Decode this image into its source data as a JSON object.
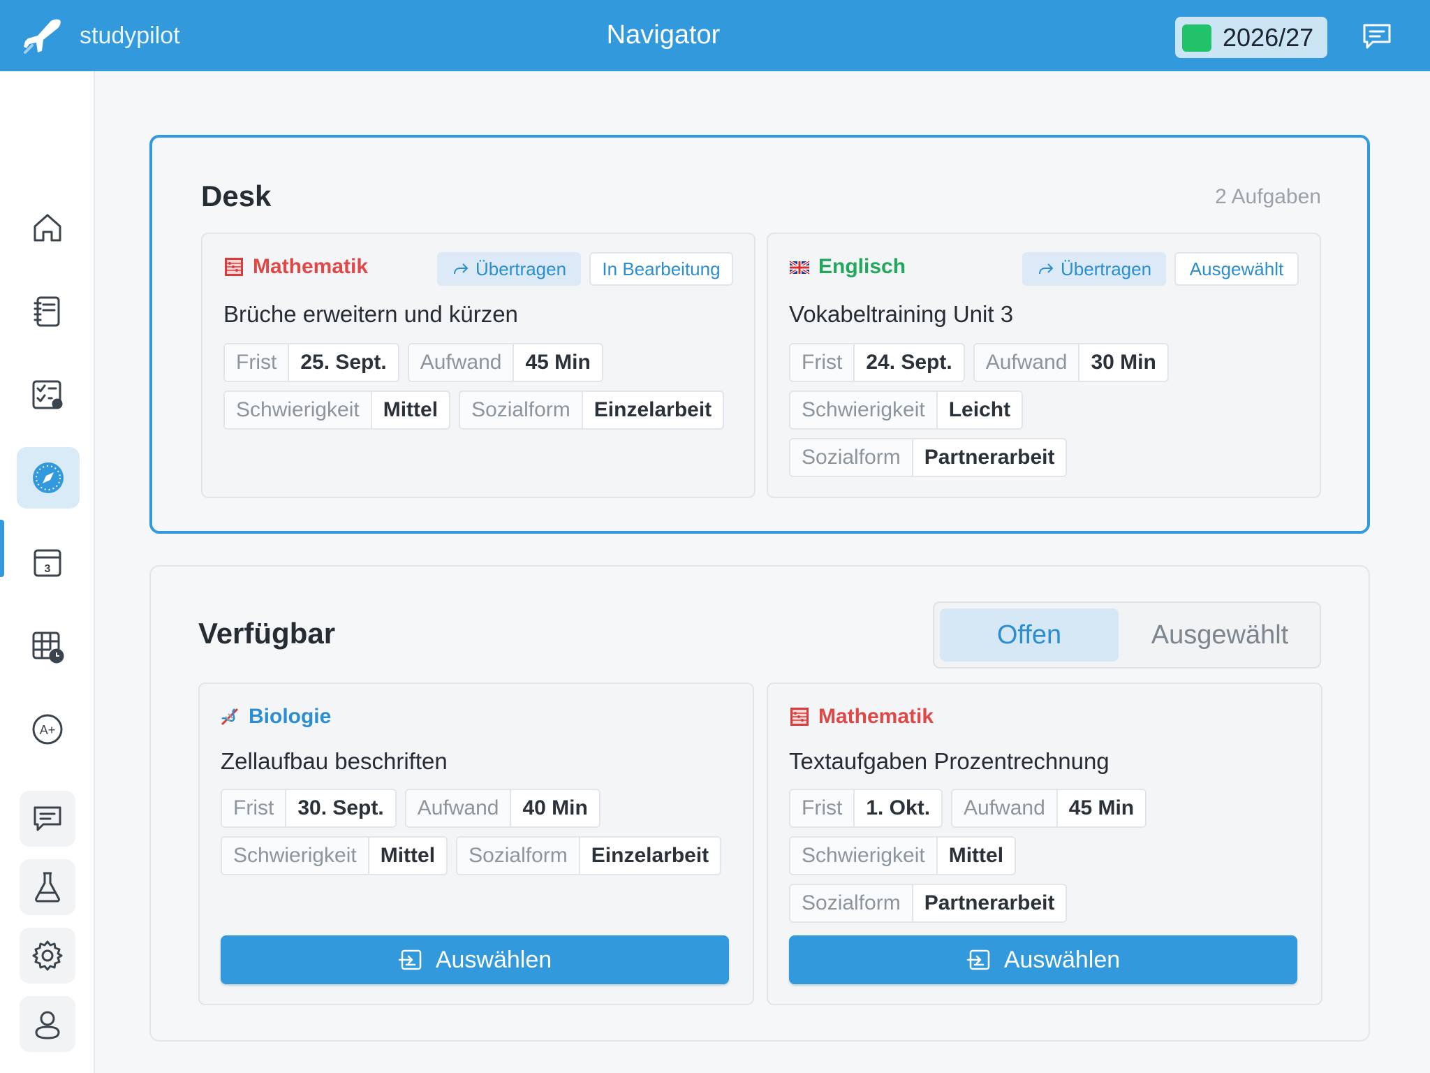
{
  "app": {
    "brand": "studypilot",
    "title": "Navigator",
    "year": "2026/27"
  },
  "colors": {
    "accent": "#3199dc",
    "math": "#e04848",
    "english": "#22a85a",
    "biology": "#2b8ed0",
    "status_dot": "#22c26b"
  },
  "sidebar": {
    "items": [
      {
        "icon": "home-icon"
      },
      {
        "icon": "notebook-icon"
      },
      {
        "icon": "task-checklist-icon"
      },
      {
        "icon": "compass-icon",
        "active": true
      },
      {
        "icon": "calendar-3-icon"
      },
      {
        "icon": "timetable-clock-icon"
      },
      {
        "icon": "grade-a-plus-icon"
      },
      {
        "icon": "chat-icon"
      },
      {
        "icon": "flask-icon"
      },
      {
        "icon": "gear-icon"
      },
      {
        "icon": "user-icon"
      }
    ]
  },
  "desk": {
    "title": "Desk",
    "count": "2 Aufgaben",
    "cards": [
      {
        "subject": "Mathematik",
        "subject_icon": "abacus-icon",
        "transfer": "Übertragen",
        "status": "In Bearbeitung",
        "title": "Brüche erweitern und kürzen",
        "frist_k": "Frist",
        "frist_v": "25. Sept.",
        "aufwand_k": "Aufwand",
        "aufwand_v": "45 Min",
        "schw_k": "Schwierigkeit",
        "schw_v": "Mittel",
        "sozial_k": "Sozialform",
        "sozial_v": "Einzelarbeit"
      },
      {
        "subject": "Englisch",
        "subject_icon": "uk-flag-icon",
        "transfer": "Übertragen",
        "status": "Ausgewählt",
        "title": "Vokabeltraining Unit 3",
        "frist_k": "Frist",
        "frist_v": "24. Sept.",
        "aufwand_k": "Aufwand",
        "aufwand_v": "30 Min",
        "schw_k": "Schwierigkeit",
        "schw_v": "Leicht",
        "sozial_k": "Sozialform",
        "sozial_v": "Partnerarbeit"
      }
    ]
  },
  "available": {
    "title": "Verfügbar",
    "tabs": [
      "Offen",
      "Ausgewählt"
    ],
    "active_tab": "Offen",
    "select_label": "Auswählen",
    "cards": [
      {
        "subject": "Biologie",
        "subject_icon": "dna-icon",
        "title": "Zellaufbau beschriften",
        "frist_k": "Frist",
        "frist_v": "30. Sept.",
        "aufwand_k": "Aufwand",
        "aufwand_v": "40 Min",
        "schw_k": "Schwierigkeit",
        "schw_v": "Mittel",
        "sozial_k": "Sozialform",
        "sozial_v": "Einzelarbeit"
      },
      {
        "subject": "Mathematik",
        "subject_icon": "abacus-icon",
        "title": "Textaufgaben Prozentrechnung",
        "frist_k": "Frist",
        "frist_v": "1. Okt.",
        "aufwand_k": "Aufwand",
        "aufwand_v": "45 Min",
        "schw_k": "Schwierigkeit",
        "schw_v": "Mittel",
        "sozial_k": "Sozialform",
        "sozial_v": "Partnerarbeit"
      }
    ]
  }
}
